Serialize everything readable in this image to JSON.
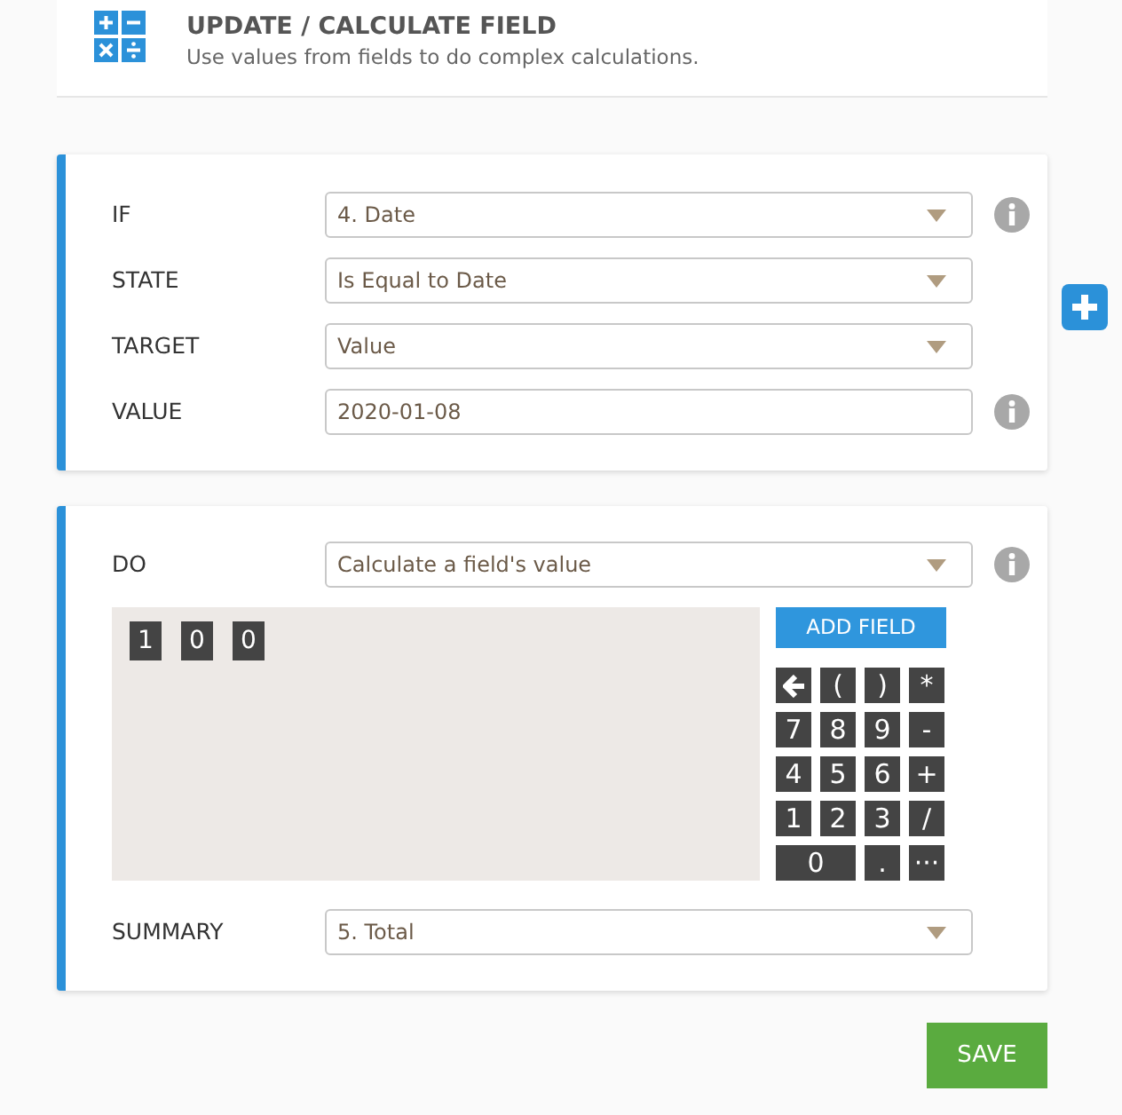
{
  "header": {
    "title": "UPDATE / CALCULATE FIELD",
    "subtitle": "Use values from fields to do complex calculations."
  },
  "condition": {
    "rows": [
      {
        "label": "IF",
        "kind": "select",
        "value": "4. Date",
        "info": true
      },
      {
        "label": "STATE",
        "kind": "select",
        "value": "Is Equal to Date",
        "info": false
      },
      {
        "label": "TARGET",
        "kind": "select",
        "value": "Value",
        "info": false
      },
      {
        "label": "VALUE",
        "kind": "input",
        "value": "2020-01-08",
        "info": true
      }
    ]
  },
  "action": {
    "do": {
      "label": "DO",
      "value": "Calculate a field's value",
      "info": true
    },
    "formula": [
      "1",
      "0",
      "0"
    ],
    "add_field": "ADD FIELD",
    "keys": [
      {
        "kind": "backspace"
      },
      {
        "kind": "text",
        "label": "("
      },
      {
        "kind": "text",
        "label": ")"
      },
      {
        "kind": "text",
        "label": "*"
      },
      {
        "kind": "text",
        "label": "7"
      },
      {
        "kind": "text",
        "label": "8"
      },
      {
        "kind": "text",
        "label": "9"
      },
      {
        "kind": "text",
        "label": "-"
      },
      {
        "kind": "text",
        "label": "4"
      },
      {
        "kind": "text",
        "label": "5"
      },
      {
        "kind": "text",
        "label": "6"
      },
      {
        "kind": "text",
        "label": "+"
      },
      {
        "kind": "text",
        "label": "1"
      },
      {
        "kind": "text",
        "label": "2"
      },
      {
        "kind": "text",
        "label": "3"
      },
      {
        "kind": "text",
        "label": "/"
      },
      {
        "kind": "wide",
        "label": "0"
      },
      {
        "kind": "text",
        "label": "."
      },
      {
        "kind": "text",
        "label": "···"
      }
    ],
    "summary": {
      "label": "SUMMARY",
      "value": "5. Total"
    }
  },
  "save": "SAVE"
}
